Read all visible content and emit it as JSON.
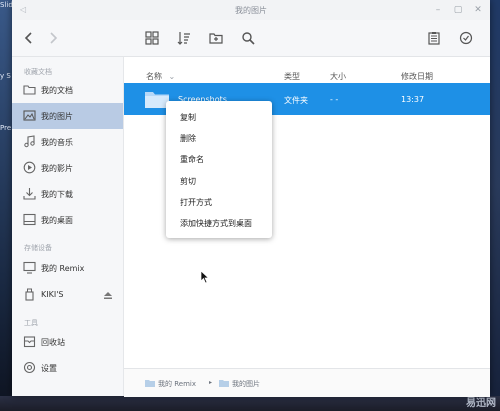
{
  "desktop": {
    "label_slides": "Slides",
    "label_ys": "y S",
    "label_pre": "Pre",
    "watermark": "易迅网"
  },
  "window": {
    "title": "我的图片"
  },
  "toolbar": {
    "icons": [
      "back-icon",
      "forward-icon",
      "grid-view-icon",
      "sort-icon",
      "new-folder-icon",
      "search-icon",
      "clipboard-icon",
      "select-check-icon"
    ]
  },
  "sidebar": {
    "section_favorites": "收藏文档",
    "section_storage": "存储设备",
    "section_tools": "工具",
    "items": [
      {
        "label": "我的文档",
        "icon": "folder-icon"
      },
      {
        "label": "我的图片",
        "icon": "image-icon",
        "active": true
      },
      {
        "label": "我的音乐",
        "icon": "music-icon"
      },
      {
        "label": "我的影片",
        "icon": "video-icon"
      },
      {
        "label": "我的下载",
        "icon": "download-icon"
      },
      {
        "label": "我的桌面",
        "icon": "desktop-icon"
      },
      {
        "label": "我的 Remix",
        "icon": "monitor-icon"
      },
      {
        "label": "KIKI'S",
        "icon": "usb-drive-icon"
      },
      {
        "label": "回收站",
        "icon": "trash-icon"
      },
      {
        "label": "设置",
        "icon": "settings-icon"
      }
    ]
  },
  "file_list": {
    "columns": {
      "name": "名称",
      "type": "类型",
      "size": "大小",
      "modified": "修改日期"
    },
    "rows": [
      {
        "name": "Screenshots",
        "type": "文件夹",
        "size": "- -",
        "modified": "13:37"
      }
    ]
  },
  "context_menu": {
    "items": [
      "复制",
      "删除",
      "重命名",
      "剪切",
      "打开方式",
      "添加快捷方式到桌面"
    ]
  },
  "status_bar": {
    "crumb_root": "我的 Remix",
    "crumb_current": "我的图片"
  },
  "colors": {
    "accent": "#1e90e6",
    "sidebar_active": "#b9cbe4"
  }
}
